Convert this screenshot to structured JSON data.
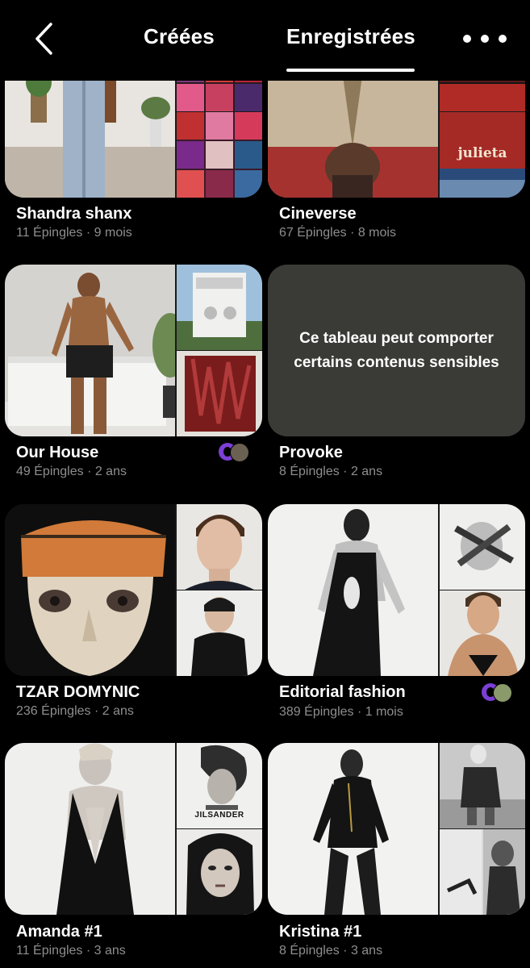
{
  "header": {
    "tabs": {
      "created": "Créées",
      "saved": "Enregistrées"
    },
    "active_tab": "saved"
  },
  "boards": [
    {
      "title": "Shandra shanx",
      "meta": "11 Épingles · 9 mois",
      "collaborators": false,
      "sensitive": false
    },
    {
      "title": "Cineverse",
      "meta": "67 Épingles · 8 mois",
      "collaborators": false,
      "sensitive": false,
      "thumb_text": "julieta"
    },
    {
      "title": "Our House",
      "meta": "49 Épingles · 2 ans",
      "collaborators": true,
      "sensitive": false
    },
    {
      "title": "Provoke",
      "meta": "8 Épingles · 2 ans",
      "collaborators": false,
      "sensitive": true,
      "sensitive_text": "Ce tableau peut comporter certains contenus sensibles"
    },
    {
      "title": "TZAR DOMYNIC",
      "meta": "236 Épingles · 2 ans",
      "collaborators": false,
      "sensitive": false
    },
    {
      "title": "Editorial fashion",
      "meta": "389 Épingles · 1 mois",
      "collaborators": true,
      "sensitive": false
    },
    {
      "title": "Amanda #1",
      "meta": "11 Épingles · 3 ans",
      "collaborators": false,
      "sensitive": false,
      "thumb_text": "JILSANDER"
    },
    {
      "title": "Kristina #1",
      "meta": "8 Épingles · 3 ans",
      "collaborators": false,
      "sensitive": false
    }
  ],
  "colors": {
    "background": "#000000",
    "meta_text": "#8e8e8e",
    "sensitive_card": "#3a3a36",
    "collab_accent": "#7b3fd6"
  },
  "icons": {
    "back": "chevron-left-icon",
    "more": "more-horizontal-icon"
  }
}
